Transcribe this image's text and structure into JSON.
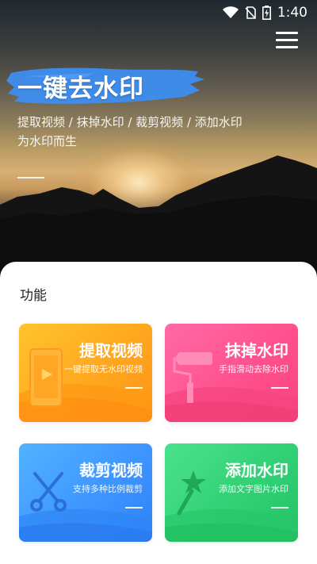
{
  "status_bar": {
    "time": "1:40"
  },
  "hero": {
    "title": "一键去水印",
    "subtitle_line1": "提取视频 / 抹掉水印 / 裁剪视频 / 添加水印",
    "subtitle_line2": "为水印而生"
  },
  "section": {
    "title": "功能"
  },
  "cards": [
    {
      "title": "提取视频",
      "desc": "一键提取无水印视频",
      "color": "#ffa51e",
      "icon": "phone-play-icon"
    },
    {
      "title": "抹掉水印",
      "desc": "手指滑动去除水印",
      "color": "#ff4f8d",
      "icon": "paint-roller-icon"
    },
    {
      "title": "裁剪视频",
      "desc": "支持多种比例裁剪",
      "color": "#3d94ff",
      "icon": "scissors-icon"
    },
    {
      "title": "添加水印",
      "desc": "添加文字图片水印",
      "color": "#2fcf73",
      "icon": "magic-wand-icon"
    }
  ]
}
